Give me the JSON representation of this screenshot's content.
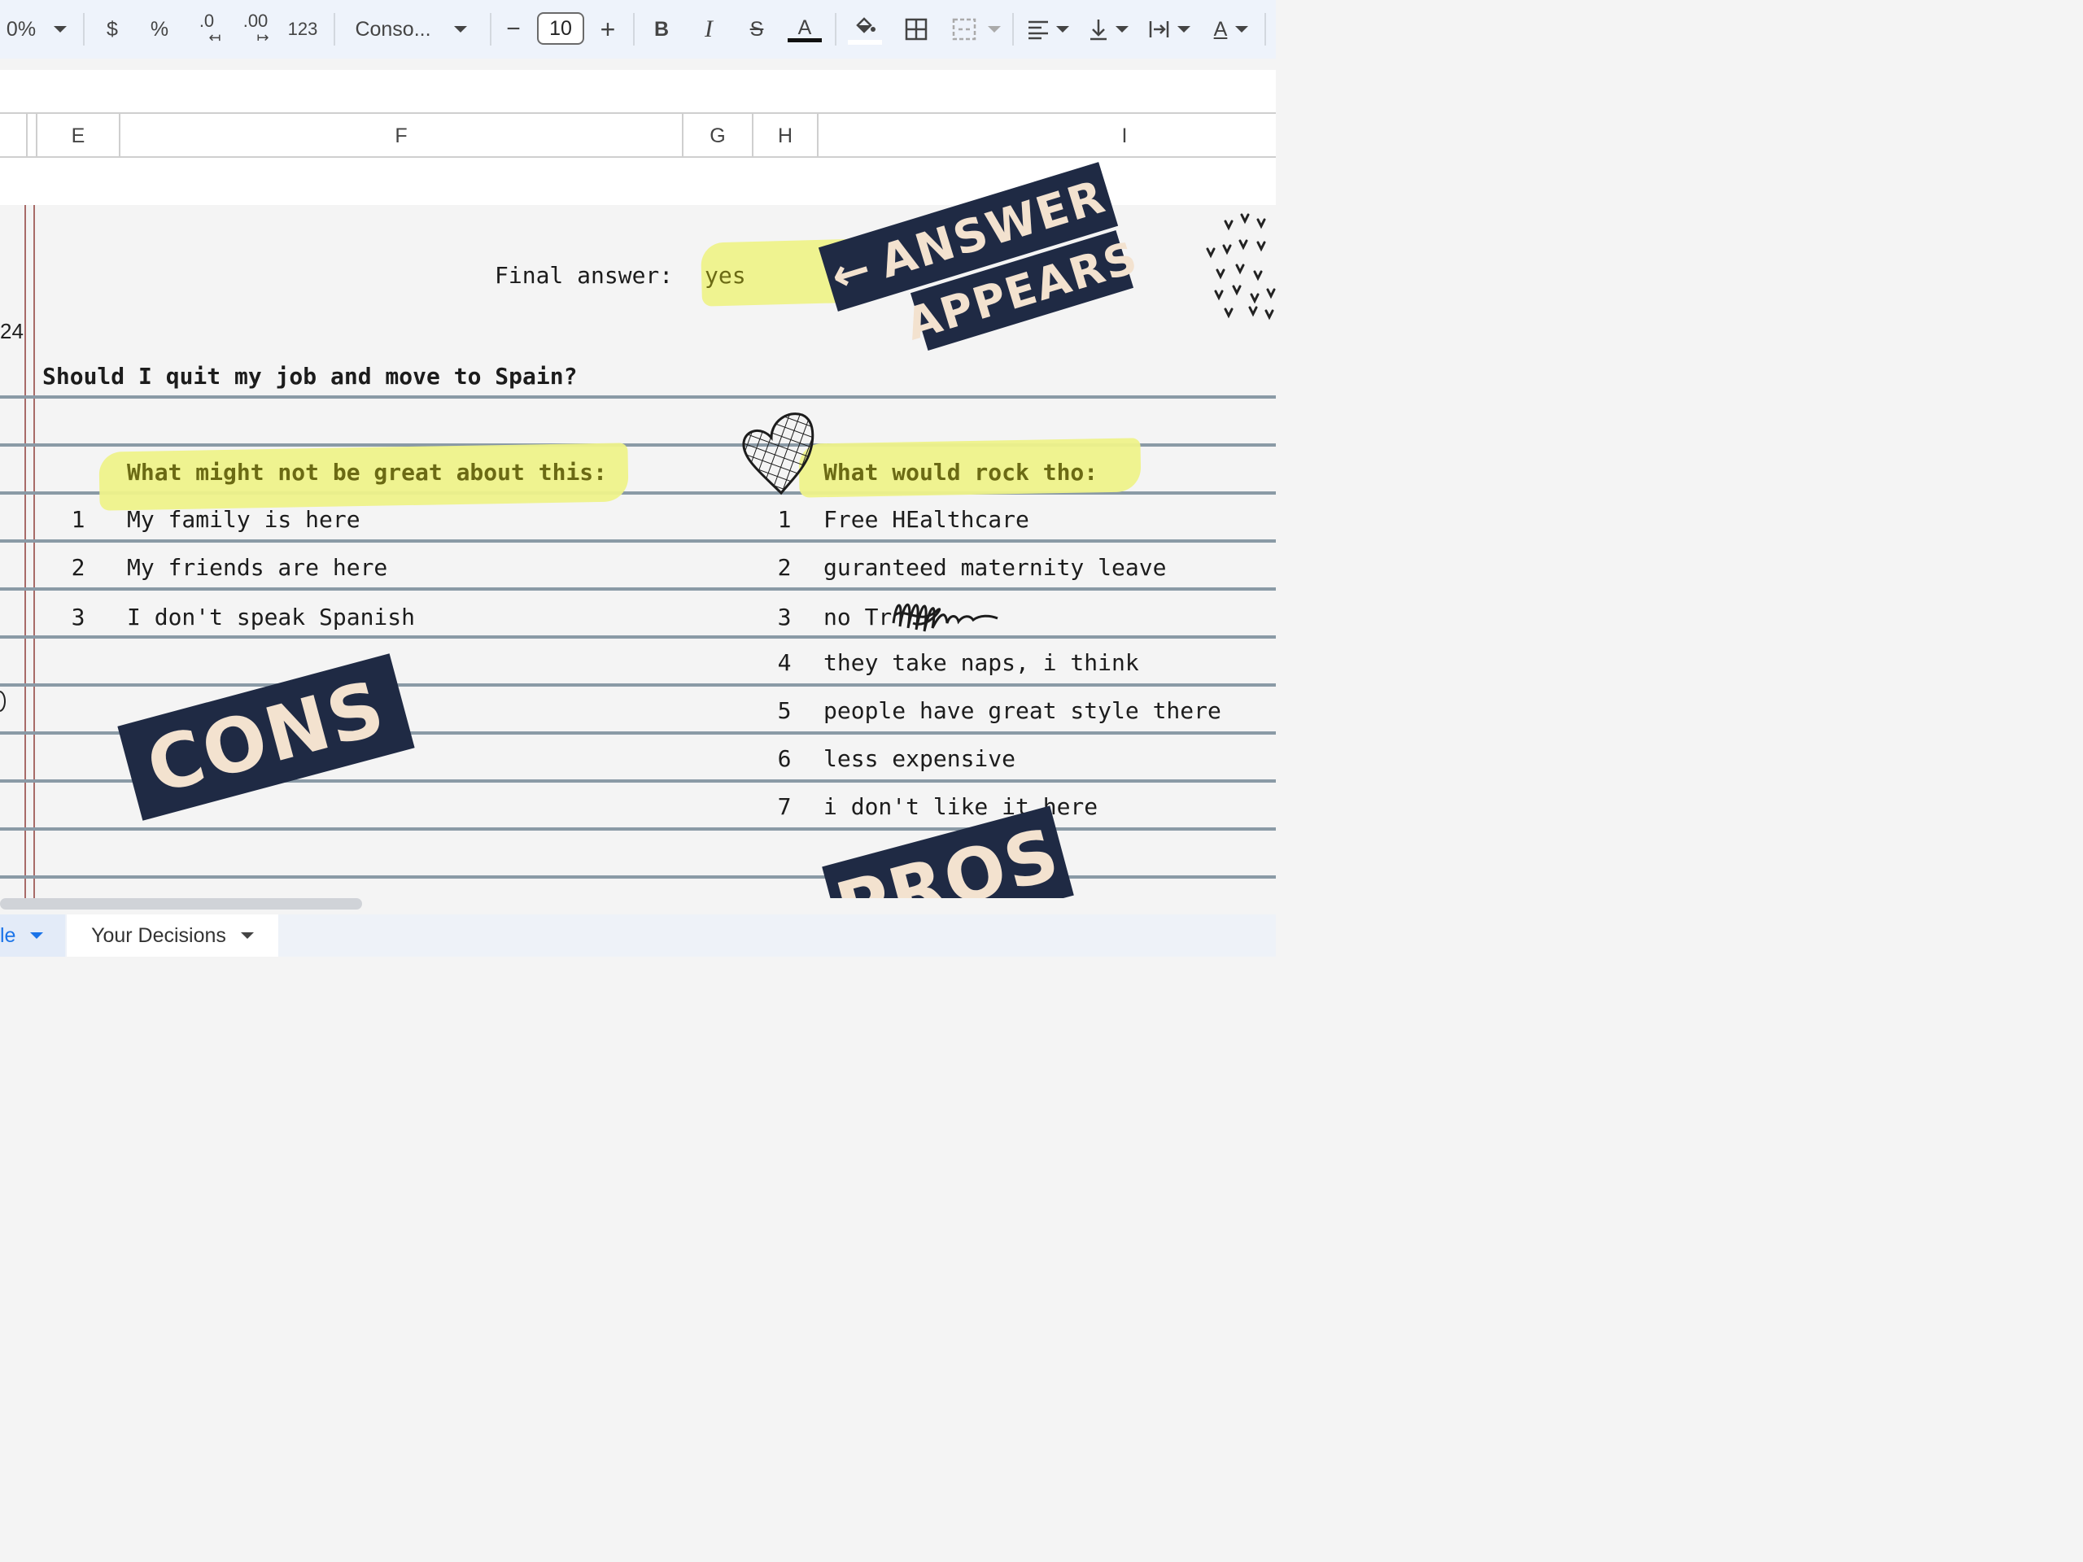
{
  "toolbar": {
    "zoom_partial": "0%",
    "currency": "$",
    "percent": "%",
    "decrease_decimal": ".0",
    "increase_decimal": ".00",
    "number_format": "123",
    "font_name": "Conso...",
    "minus": "−",
    "font_size": "10",
    "plus": "+",
    "bold": "B",
    "italic": "I",
    "strikethrough": "S",
    "text_color": "A",
    "text_color_bar": "#111111",
    "format_color": "A"
  },
  "columns": [
    "E",
    "F",
    "G",
    "H",
    "I"
  ],
  "row_partial_number": "24",
  "sheet": {
    "final_answer_label": "Final answer:",
    "final_answer_value": "yes",
    "question": "Should I quit my job and move to Spain?",
    "cons_header": "What might not be great about this:",
    "pros_header": "What would rock tho:",
    "cons": [
      {
        "n": "1",
        "text": "My family is here"
      },
      {
        "n": "2",
        "text": "My friends are here"
      },
      {
        "n": "3",
        "text": "I don't speak Spanish"
      }
    ],
    "pros": [
      {
        "n": "1",
        "text": "Free HEalthcare"
      },
      {
        "n": "2",
        "text": "guranteed maternity leave"
      },
      {
        "n": "3",
        "text": "no Tr"
      },
      {
        "n": "4",
        "text": "they take naps, i think"
      },
      {
        "n": "5",
        "text": "people have great style there"
      },
      {
        "n": "6",
        "text": "less expensive"
      },
      {
        "n": "7",
        "text": "i don't like it here"
      }
    ]
  },
  "stickers": {
    "answer_line1": "ANSWER",
    "answer_line2": "APPEARS",
    "arrow": "←",
    "cons": "CONS",
    "pros": "PROS"
  },
  "tabs": [
    {
      "label": "le",
      "active": true
    },
    {
      "label": "Your Decisions",
      "active": false
    }
  ],
  "colors": {
    "highlight": "#eef28a",
    "sticker_bg": "#1f2a44",
    "sticker_text": "#f3e2cf",
    "rule_line": "#8a9aa6",
    "margin_line": "#a86b68",
    "header_text": "#6b6a14",
    "active_tab": "#1a73e8"
  }
}
